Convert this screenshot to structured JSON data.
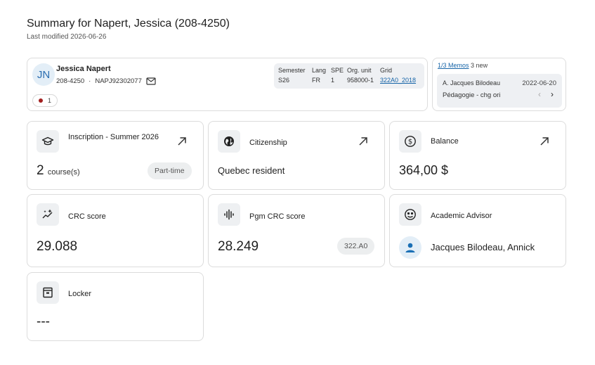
{
  "header": {
    "title": "Summary for Napert, Jessica (208-4250)",
    "last_modified": "Last modified 2026-06-26"
  },
  "profile": {
    "initials": "JN",
    "name": "Jessica Napert",
    "student_id": "208-4250",
    "separator": "·",
    "code": "NAPJ92302077",
    "alert_count": "1",
    "info": {
      "semester_label": "Semester",
      "semester_value": "S26",
      "lang_label": "Lang",
      "lang_value": "FR",
      "spe_label": "SPE",
      "spe_value": "1",
      "org_label": "Org. unit",
      "org_value": "958000-1",
      "grid_label": "Grid",
      "grid_value": "322A0_2018"
    }
  },
  "memos": {
    "link": "1/3 Memos",
    "new_count": "3 new",
    "author": "A. Jacques Bilodeau",
    "date": "2022-06-20",
    "text": "Pédagogie - chg ori",
    "prev": "‹",
    "next": "›"
  },
  "cards": {
    "inscription": {
      "title": "Inscription - Summer 2026",
      "count": "2",
      "unit": "course(s)",
      "tag": "Part-time",
      "icon": "graduation-cap-icon"
    },
    "citizenship": {
      "title": "Citizenship",
      "value": "Quebec resident",
      "icon": "globe-icon"
    },
    "balance": {
      "title": "Balance",
      "value": "364,00 $",
      "icon": "dollar-icon"
    },
    "crc": {
      "title": "CRC score",
      "value": "29.088",
      "icon": "sparkle-chart-icon"
    },
    "pgm_crc": {
      "title": "Pgm CRC score",
      "value": "28.249",
      "tag": "322.A0",
      "icon": "waveform-icon"
    },
    "advisor": {
      "title": "Academic Advisor",
      "value": "Jacques Bilodeau, Annick",
      "icon": "advisor-face-icon"
    },
    "locker": {
      "title": "Locker",
      "value": "---",
      "icon": "locker-icon"
    }
  },
  "colors": {
    "link": "#1765a8",
    "alert_dot": "#a32020",
    "advisor_avatar": "#1a6fb5"
  }
}
